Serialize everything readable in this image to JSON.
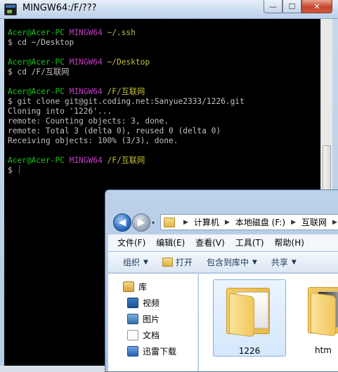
{
  "terminal": {
    "title": "MINGW64:/F/???",
    "buttons": {
      "minimize": "—",
      "maximize": "☐",
      "close": "✕"
    },
    "lines": [
      {
        "user": "Acer@Acer-PC",
        "host": "MINGW64",
        "path": "~/.ssh"
      },
      {
        "text": "$ cd ~/Desktop"
      },
      {
        "text": ""
      },
      {
        "user": "Acer@Acer-PC",
        "host": "MINGW64",
        "path": "~/Desktop"
      },
      {
        "text": "$ cd /F/互联网"
      },
      {
        "text": ""
      },
      {
        "user": "Acer@Acer-PC",
        "host": "MINGW64",
        "path": "/F/互联网"
      },
      {
        "text": "$ git clone git@git.coding.net:Sanyue2333/1226.git"
      },
      {
        "text": "Cloning into '1226'..."
      },
      {
        "text": "remote: Counting objects: 3, done."
      },
      {
        "text": "remote: Total 3 (delta 0), reused 0 (delta 0)"
      },
      {
        "text": "Receiving objects: 100% (3/3), done."
      },
      {
        "text": ""
      },
      {
        "user": "Acer@Acer-PC",
        "host": "MINGW64",
        "path": "/F/互联网"
      },
      {
        "text": "$ "
      }
    ]
  },
  "explorer": {
    "nav": {
      "back": "◀",
      "forward": "▶",
      "dropdown": "▾"
    },
    "breadcrumb": [
      "计算机",
      "本地磁盘 (F:)",
      "互联网"
    ],
    "breadcrumb_sep": "▶",
    "menu": [
      "文件(F)",
      "编辑(E)",
      "查看(V)",
      "工具(T)",
      "帮助(H)"
    ],
    "toolbar": [
      {
        "label": "组织",
        "dropdown": "▼"
      },
      {
        "label": "打开",
        "dropdown": ""
      },
      {
        "label": "包含到库中",
        "dropdown": "▼"
      },
      {
        "label": "共享",
        "dropdown": "▼"
      }
    ],
    "nav_pane": {
      "library": "库",
      "items": [
        "视频",
        "图片",
        "文档",
        "迅雷下载"
      ]
    },
    "files": [
      {
        "name": "1226",
        "selected": true
      },
      {
        "name": "htm",
        "selected": false
      }
    ]
  }
}
